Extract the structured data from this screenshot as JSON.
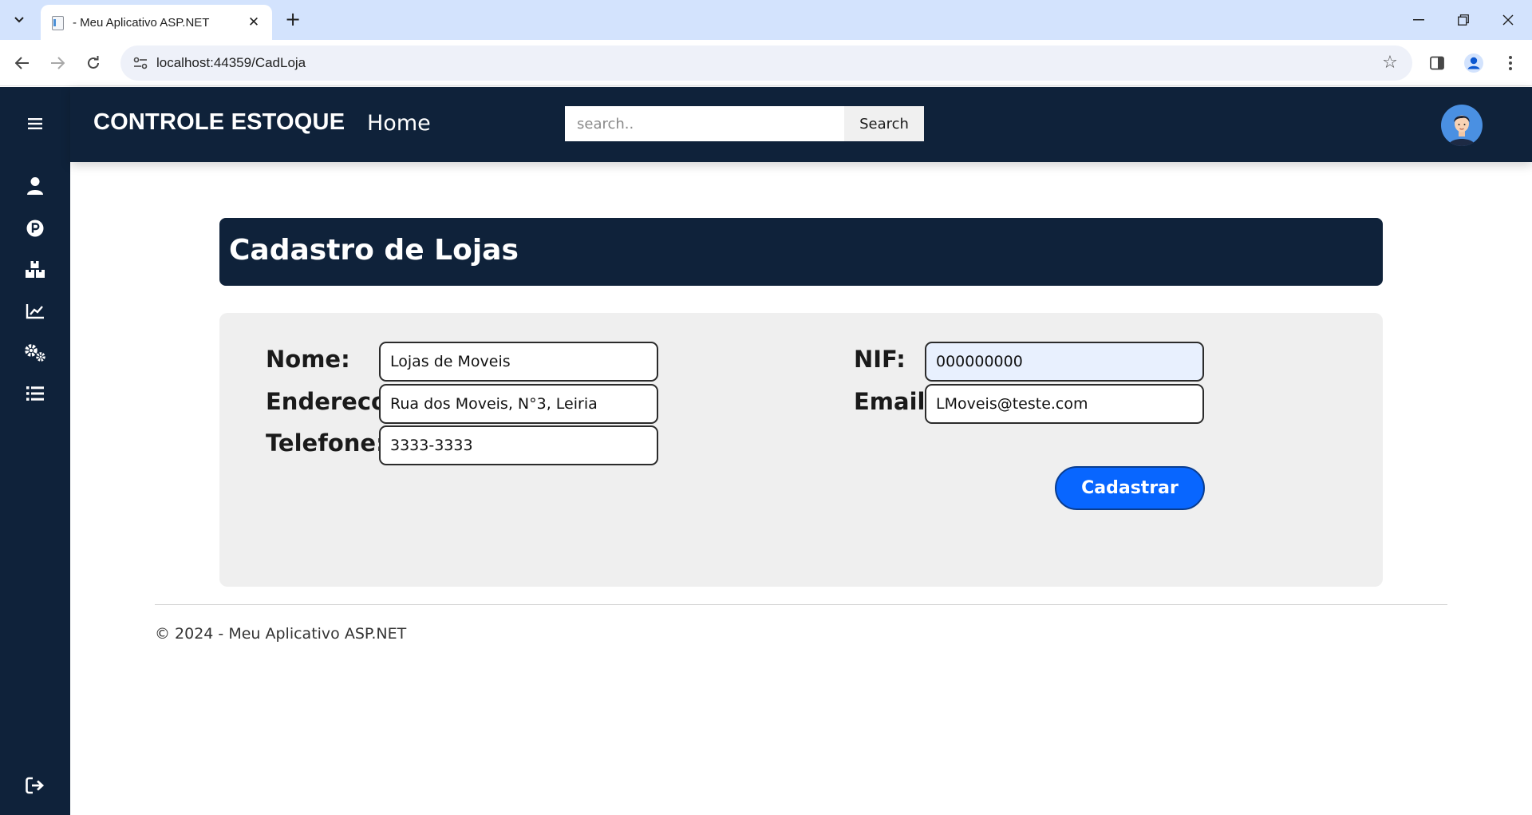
{
  "browser": {
    "tab_title": "- Meu Aplicativo ASP.NET",
    "url": "localhost:44359/CadLoja"
  },
  "app": {
    "brand": "CONTROLE ESTOQUE",
    "home_link": "Home",
    "search": {
      "placeholder": "search..",
      "button_label": "Search"
    },
    "sidebar_icons": [
      "menu-icon",
      "user-icon",
      "parking-icon",
      "boxes-icon",
      "chart-line-icon",
      "gears-icon",
      "list-icon",
      "sign-out-icon"
    ],
    "accent_color": "#0f223a",
    "button_color": "#0866ff"
  },
  "page": {
    "title": "Cadastro de Lojas",
    "form": {
      "nome": {
        "label": "Nome:",
        "value": "Lojas de Moveis"
      },
      "endereco": {
        "label": "Endereco:",
        "value": "Rua dos Moveis, N°3, Leiria"
      },
      "telefone": {
        "label": "Telefone:",
        "value": "3333-3333"
      },
      "nif": {
        "label": "NIF:",
        "value": "000000000"
      },
      "email": {
        "label": "Email:",
        "value": "LMoveis@teste.com"
      },
      "submit_label": "Cadastrar"
    }
  },
  "footer": {
    "text": "© 2024 - Meu Aplicativo ASP.NET"
  }
}
